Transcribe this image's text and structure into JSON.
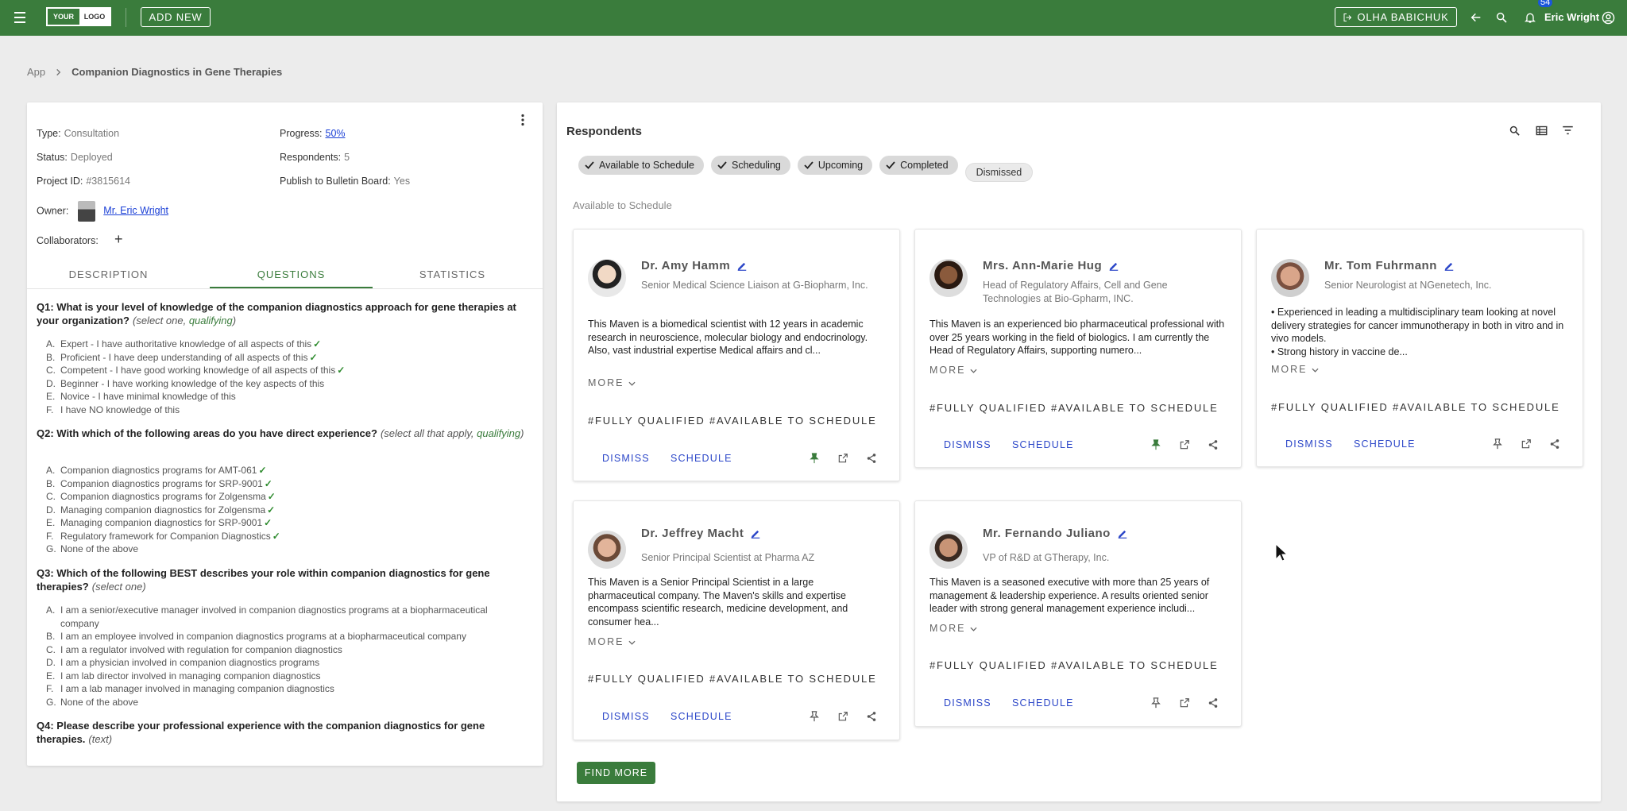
{
  "topbar": {
    "logo_left": "YOUR",
    "logo_right": "LOGO",
    "add_new": "ADD NEW",
    "user_button": "OLHA BABICHUK",
    "notifications_count": "54",
    "user_name": "Eric Wright"
  },
  "breadcrumb": {
    "root": "App",
    "current": "Companion Diagnostics in Gene Therapies"
  },
  "project": {
    "type_label": "Type:",
    "type_value": "Consultation",
    "status_label": "Status:",
    "status_value": "Deployed",
    "id_label": "Project ID:",
    "id_value": "#3815614",
    "progress_label": "Progress:",
    "progress_value": "50%",
    "respondents_label": "Respondents:",
    "respondents_value": "5",
    "publish_label": "Publish to Bulletin Board:",
    "publish_value": "Yes",
    "owner_label": "Owner:",
    "owner_value": "Mr. Eric Wright",
    "collaborators_label": "Collaborators:"
  },
  "tabs": [
    "DESCRIPTION",
    "QUESTIONS",
    "STATISTICS"
  ],
  "questions": [
    {
      "title": "Q1: What is your level of knowledge of the companion diagnostics approach for gene therapies at your organization?",
      "note_a": "(select one, ",
      "note_b": "qualifying",
      "note_c": ")",
      "options": [
        {
          "l": "A.",
          "t": "Expert - I have authoritative knowledge of all aspects of this",
          "c": "✓"
        },
        {
          "l": "B.",
          "t": "Proficient - I have deep understanding of all aspects of this",
          "c": "✓"
        },
        {
          "l": "C.",
          "t": "Competent - I have good working knowledge of all aspects of this",
          "c": "✓"
        },
        {
          "l": "D.",
          "t": "Beginner - I have working knowledge of the key aspects of this",
          "c": ""
        },
        {
          "l": "E.",
          "t": "Novice - I have minimal knowledge of this",
          "c": ""
        },
        {
          "l": "F.",
          "t": "I have NO knowledge of this",
          "c": ""
        }
      ]
    },
    {
      "title": "Q2: With which of the following areas do you have direct experience?",
      "note_a": "(select all that apply, ",
      "note_b": "qualifying",
      "note_c": ")",
      "options": [
        {
          "l": "A.",
          "t": "Companion diagnostics programs for AMT-061",
          "c": "✓"
        },
        {
          "l": "B.",
          "t": "Companion diagnostics programs for SRP-9001",
          "c": "✓"
        },
        {
          "l": "C.",
          "t": "Companion diagnostics programs for Zolgensma",
          "c": "✓"
        },
        {
          "l": "D.",
          "t": "Managing companion diagnostics for Zolgensma",
          "c": "✓"
        },
        {
          "l": "E.",
          "t": "Managing companion diagnostics for SRP-9001",
          "c": "✓"
        },
        {
          "l": "F.",
          "t": "Regulatory framework for Companion Diagnostics",
          "c": "✓"
        },
        {
          "l": "G.",
          "t": "None of the above",
          "c": ""
        }
      ]
    },
    {
      "title": "Q3: Which of the following BEST describes your role within companion diagnostics for gene therapies?",
      "note_a": "(select one)",
      "note_b": "",
      "note_c": "",
      "options": [
        {
          "l": "A.",
          "t": "I am a senior/executive manager involved in companion diagnostics programs at a biopharmaceutical company",
          "c": ""
        },
        {
          "l": "B.",
          "t": "I am an employee involved in companion diagnostics programs at a biopharmaceutical company",
          "c": ""
        },
        {
          "l": "C.",
          "t": "I am a regulator involved with regulation for companion diagnostics",
          "c": ""
        },
        {
          "l": "D.",
          "t": "I am a physician involved in companion diagnostics programs",
          "c": ""
        },
        {
          "l": "E.",
          "t": "I am lab director involved in managing companion diagnostics",
          "c": ""
        },
        {
          "l": "F.",
          "t": "I am a lab manager involved in managing companion diagnostics",
          "c": ""
        },
        {
          "l": "G.",
          "t": "None of the above",
          "c": ""
        }
      ]
    },
    {
      "title": "Q4: Please describe your professional experience with the companion diagnostics for gene therapies.",
      "note_a": "(text)",
      "note_b": "",
      "note_c": ""
    }
  ],
  "respondents": {
    "title": "Respondents",
    "chips": [
      "Available to Schedule",
      "Scheduling",
      "Upcoming",
      "Completed"
    ],
    "chip_off": "Dismissed",
    "section": "Available to Schedule",
    "more_label": "MORE",
    "tags": "#FULLY QUALIFIED  #AVAILABLE TO SCHEDULE",
    "dismiss_label": "DISMISS",
    "schedule_label": "SCHEDULE",
    "find_more": "FIND MORE",
    "cards": [
      {
        "name": "Dr. Amy Hamm",
        "title": "Senior Medical Science Liaison at G-Biopharm, Inc.",
        "bio": "This Maven is a biomedical scientist with 12 years in academic research in neuroscience, molecular biology and endocrinology. Also, vast industrial expertise Medical affairs and cl..."
      },
      {
        "name": "Mrs. Ann-Marie Hug",
        "title": "Head of Regulatory Affairs, Cell and Gene Technologies at Bio-Gpharm, INC.",
        "bio": "This Maven is an experienced bio pharmaceutical professional with over 25 years working in the field of biologics. I am currently the Head of Regulatory Affairs, supporting numero..."
      },
      {
        "name": "Mr. Tom Fuhrmann",
        "title": "Senior Neurologist at NGenetech, Inc.",
        "bio1": "• Experienced in leading a multidisciplinary team looking at novel delivery strategies for cancer immunotherapy in both in vitro and in vivo models.",
        "bio2": "• Strong history in vaccine de..."
      },
      {
        "name": "Dr. Jeffrey Macht",
        "title": "Senior Principal Scientist at Pharma AZ",
        "bio": "This Maven is a Senior Principal Scientist in a large pharmaceutical company. The Maven's skills and expertise encompass scientific research, medicine development, and consumer hea..."
      },
      {
        "name": "Mr. Fernando Juliano",
        "title": "VP of R&D at GTherapy, Inc.",
        "bio": "This Maven is a seasoned executive with more than 25 years of management & leadership experience. A results oriented senior leader with strong general management experience includi..."
      }
    ]
  },
  "colors": {
    "brand": "#3a7c3c",
    "link": "#1a3fd6",
    "action": "#2b46c8",
    "check": "#2e8b2e"
  },
  "icons": [
    "menu-icon",
    "logout-icon",
    "arrow-back-icon",
    "search-icon",
    "bell-icon",
    "account-circle-icon",
    "more-vert-icon",
    "plus-icon",
    "table-view-icon",
    "filter-icon",
    "check-icon",
    "pencil-icon",
    "chevron-down-icon",
    "pin-icon",
    "open-in-new-icon",
    "share-icon",
    "cursor-icon"
  ]
}
